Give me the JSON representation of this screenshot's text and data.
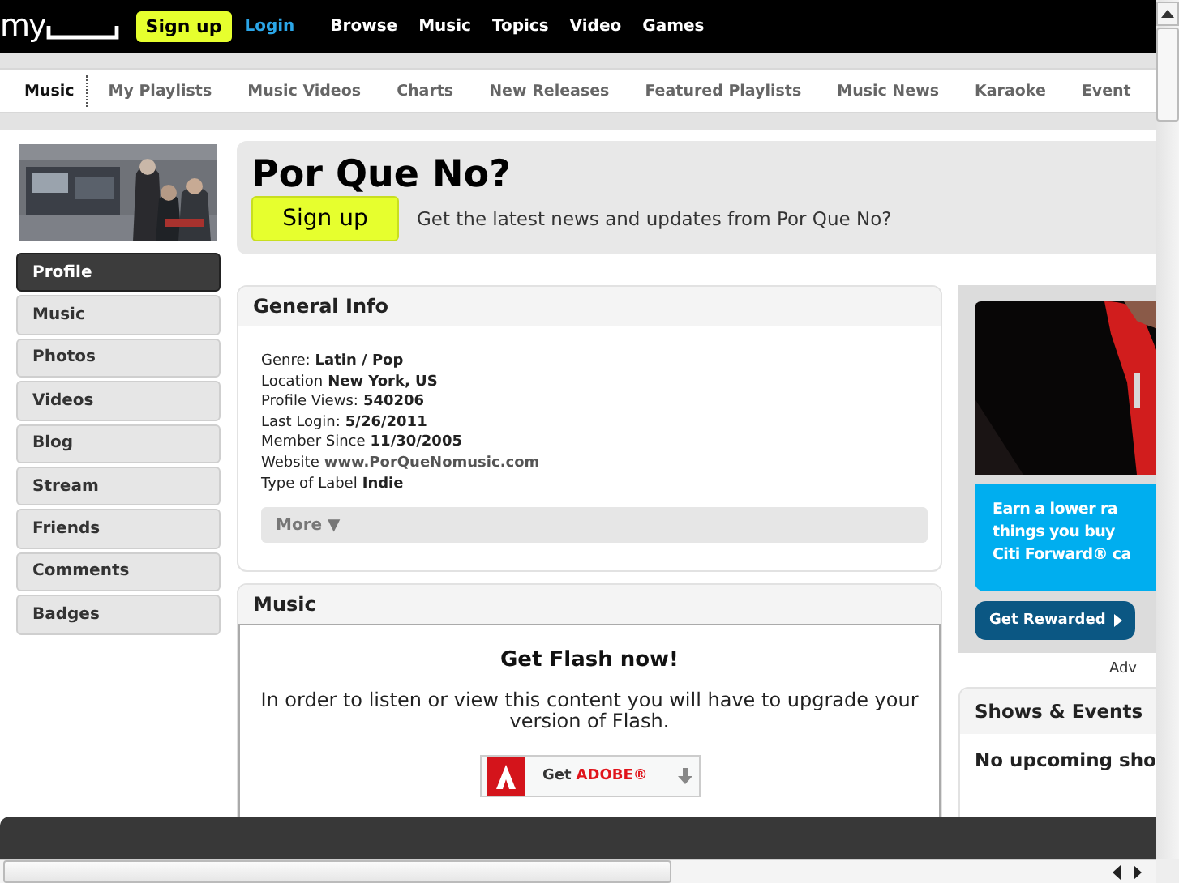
{
  "topbar": {
    "logo": "my",
    "signup": "Sign up",
    "login": "Login",
    "links": [
      "Browse",
      "Music",
      "Topics",
      "Video",
      "Games"
    ]
  },
  "subnav": [
    {
      "label": "Music",
      "selected": true
    },
    {
      "label": "My Playlists",
      "selected": false
    },
    {
      "label": "Music Videos",
      "selected": false
    },
    {
      "label": "Charts",
      "selected": false
    },
    {
      "label": "New Releases",
      "selected": false
    },
    {
      "label": "Featured Playlists",
      "selected": false
    },
    {
      "label": "Music News",
      "selected": false
    },
    {
      "label": "Karaoke",
      "selected": false
    },
    {
      "label": "Event",
      "selected": false
    }
  ],
  "profile": {
    "name": "Por Que No?",
    "signup": "Sign up",
    "tagline": "Get the latest news and updates from Por Que No?"
  },
  "sidebar": [
    {
      "label": "Profile",
      "selected": true
    },
    {
      "label": "Music",
      "selected": false
    },
    {
      "label": "Photos",
      "selected": false
    },
    {
      "label": "Videos",
      "selected": false
    },
    {
      "label": "Blog",
      "selected": false
    },
    {
      "label": "Stream",
      "selected": false
    },
    {
      "label": "Friends",
      "selected": false
    },
    {
      "label": "Comments",
      "selected": false
    },
    {
      "label": "Badges",
      "selected": false
    }
  ],
  "general_info": {
    "title": "General Info",
    "lines": [
      {
        "label": "Genre:",
        "value": "Latin / Pop",
        "kind": "text"
      },
      {
        "label": "Location",
        "value": "New York, US",
        "kind": "text"
      },
      {
        "label": "Profile Views:",
        "value": "540206",
        "kind": "text"
      },
      {
        "label": "Last Login:",
        "value": "5/26/2011",
        "kind": "text"
      },
      {
        "label": "Member Since",
        "value": "11/30/2005",
        "kind": "text"
      },
      {
        "label": "Website",
        "value": "www.PorQueNomusic.com",
        "kind": "link"
      },
      {
        "label": "Type of Label",
        "value": "Indie",
        "kind": "text"
      }
    ],
    "more": "More ▼"
  },
  "music": {
    "title": "Music",
    "flash_title": "Get Flash now!",
    "flash_text": "In order to listen or view this content you will have to upgrade your version of Flash.",
    "badge_get": "Get",
    "badge_brand": "ADOBE®"
  },
  "ad": {
    "lines": [
      "Earn a lower ra",
      "things you buy",
      "Citi Forward® ca"
    ],
    "button": "Get Rewarded",
    "label": "Adv"
  },
  "shows": {
    "title": "Shows & Events",
    "text": "No upcoming sho"
  }
}
